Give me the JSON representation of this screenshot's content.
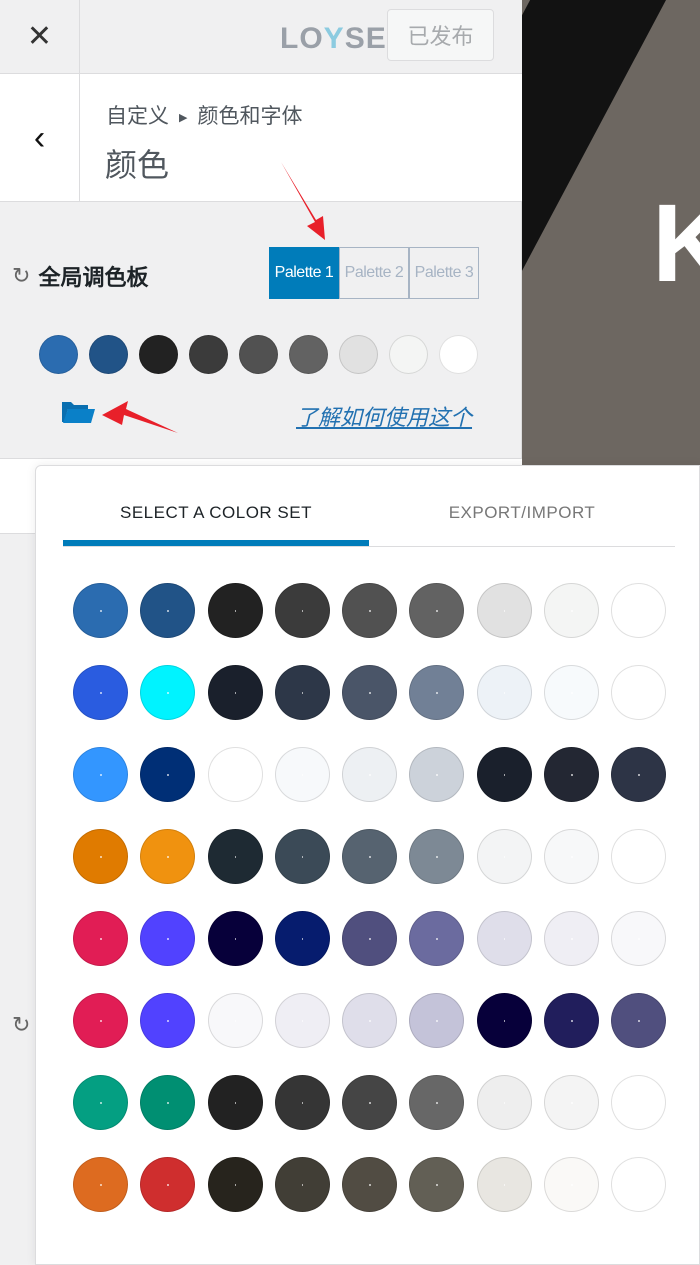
{
  "topbar": {
    "close_icon": "close-icon",
    "logo": "LOYSEO",
    "publish_label": "已发布"
  },
  "header": {
    "breadcrumb": [
      "自定义",
      "颜色和字体"
    ],
    "title": "颜色"
  },
  "palette": {
    "label": "全局调色板",
    "tabs": [
      {
        "label": "Palette 1",
        "active": true
      },
      {
        "label": "Palette 2",
        "active": false
      },
      {
        "label": "Palette 3",
        "active": false
      }
    ],
    "colors": [
      "#2b6cb0",
      "#215387",
      "#222222",
      "#3b3b3b",
      "#515151",
      "#626262",
      "#e1e1e1",
      "#f4f5f4",
      "#ffffff"
    ],
    "learn_link": "了解如何使用这个"
  },
  "accent": "#007cba",
  "preview": {
    "letter": "K"
  },
  "popup": {
    "tabs": [
      {
        "label": "SELECT A COLOR SET",
        "active": true
      },
      {
        "label": "EXPORT/IMPORT",
        "active": false
      }
    ],
    "color_sets": [
      [
        "#2b6cb0",
        "#215387",
        "#222222",
        "#3b3b3b",
        "#515151",
        "#626262",
        "#e1e1e1",
        "#f4f5f4",
        "#ffffff"
      ],
      [
        "#2a5ce0",
        "#00f3ff",
        "#1a202c",
        "#2d3748",
        "#4a5568",
        "#718096",
        "#edf2f7",
        "#f7fafc",
        "#ffffff"
      ],
      [
        "#3396ff",
        "#002f76",
        "#ffffff",
        "#f7f9fb",
        "#edf0f3",
        "#ccd2da",
        "#1a202c",
        "#232733",
        "#2d3446"
      ],
      [
        "#e07b00",
        "#f0920f",
        "#1e2a33",
        "#3b4a57",
        "#566370",
        "#7d8995",
        "#f3f4f5",
        "#f7f8f9",
        "#ffffff"
      ],
      [
        "#e11d55",
        "#5142ff",
        "#07003a",
        "#061c6e",
        "#504f7e",
        "#6b6b9f",
        "#dfdeea",
        "#efeef4",
        "#f8f8fa"
      ],
      [
        "#e11d55",
        "#5142ff",
        "#f8f8fa",
        "#efeef4",
        "#dfdeea",
        "#c4c3d9",
        "#07003a",
        "#211e5c",
        "#504f7e"
      ],
      [
        "#049f82",
        "#008f72",
        "#222222",
        "#353535",
        "#454545",
        "#676767",
        "#eeeeee",
        "#f4f4f4",
        "#ffffff"
      ],
      [
        "#dd6b20",
        "#cf2e2e",
        "#27241d",
        "#413e36",
        "#514c43",
        "#625f55",
        "#e8e6e1",
        "#faf9f7",
        "#ffffff"
      ]
    ]
  }
}
